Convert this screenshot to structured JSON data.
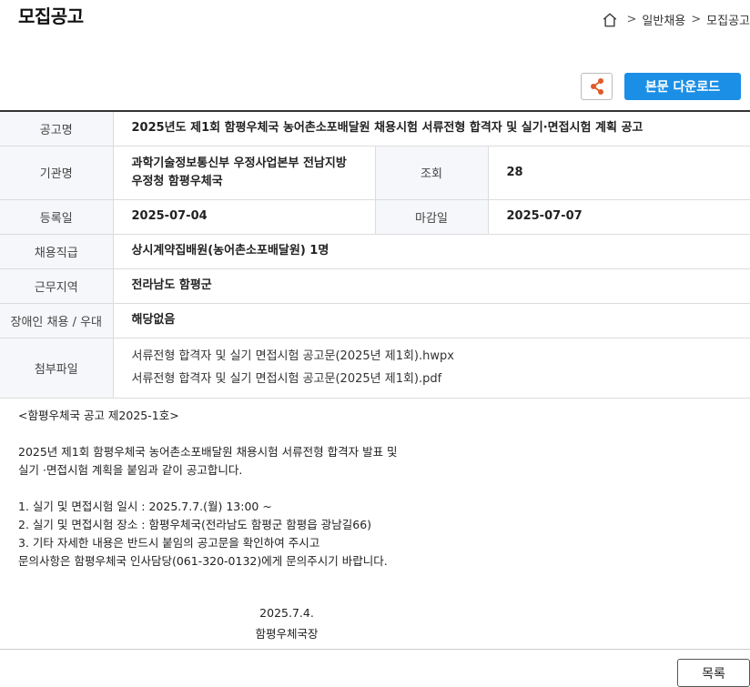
{
  "page": {
    "title": "모집공고"
  },
  "breadcrumb": {
    "items": [
      "일반채용",
      "모집공고"
    ],
    "separator": ">"
  },
  "buttons": {
    "download": "본문 다운로드",
    "list": "목록"
  },
  "info": {
    "title_label": "공고명",
    "title_value": "2025년도 제1회 함평우체국 농어촌소포배달원 채용시험 서류전형 합격자 및 실기·면접시험 계획 공고",
    "agency_label": "기관명",
    "agency_line1": "과학기술정보통신부 우정사업본부 전남지방",
    "agency_line2": "우정청 함평우체국",
    "views_label": "조회",
    "views_value": "28",
    "reg_label": "등록일",
    "reg_value": "2025-07-04",
    "deadline_label": "마감일",
    "deadline_value": "2025-07-07",
    "position_label": "채용직급",
    "position_value": "상시계약집배원(농어촌소포배달원) 1명",
    "region_label": "근무지역",
    "region_value": "전라남도 함평군",
    "disabled_label": "장애인 채용 / 우대",
    "disabled_value": "해당없음",
    "files_label": "첨부파일",
    "files": [
      "서류전형 합격자 및 실기 면접시험 공고문(2025년 제1회).hwpx",
      "서류전형 합격자 및 실기 면접시험 공고문(2025년 제1회).pdf"
    ]
  },
  "body": {
    "lines": [
      "<함평우체국 공고 제2025-1호>",
      "",
      "2025년 제1회 함평우체국 농어촌소포배달원 채용시험 서류전형 합격자 발표 및",
      "실기 ·면접시험 계획을 붙임과 같이 공고합니다.",
      "",
      "1. 실기 및 면접시험 일시 : 2025.7.7.(월) 13:00 ~",
      "2. 실기 및 면접시험 장소 : 함평우체국(전라남도 함평군 함평읍 광남길66)",
      "3. 기타 자세한 내용은 반드시 붙임의 공고문을 확인하여 주시고",
      "문의사항은 함평우체국 인사담당(061-320-0132)에게 문의주시기 바랍니다."
    ],
    "date": "2025.7.4.",
    "signer": "함평우체국장"
  }
}
